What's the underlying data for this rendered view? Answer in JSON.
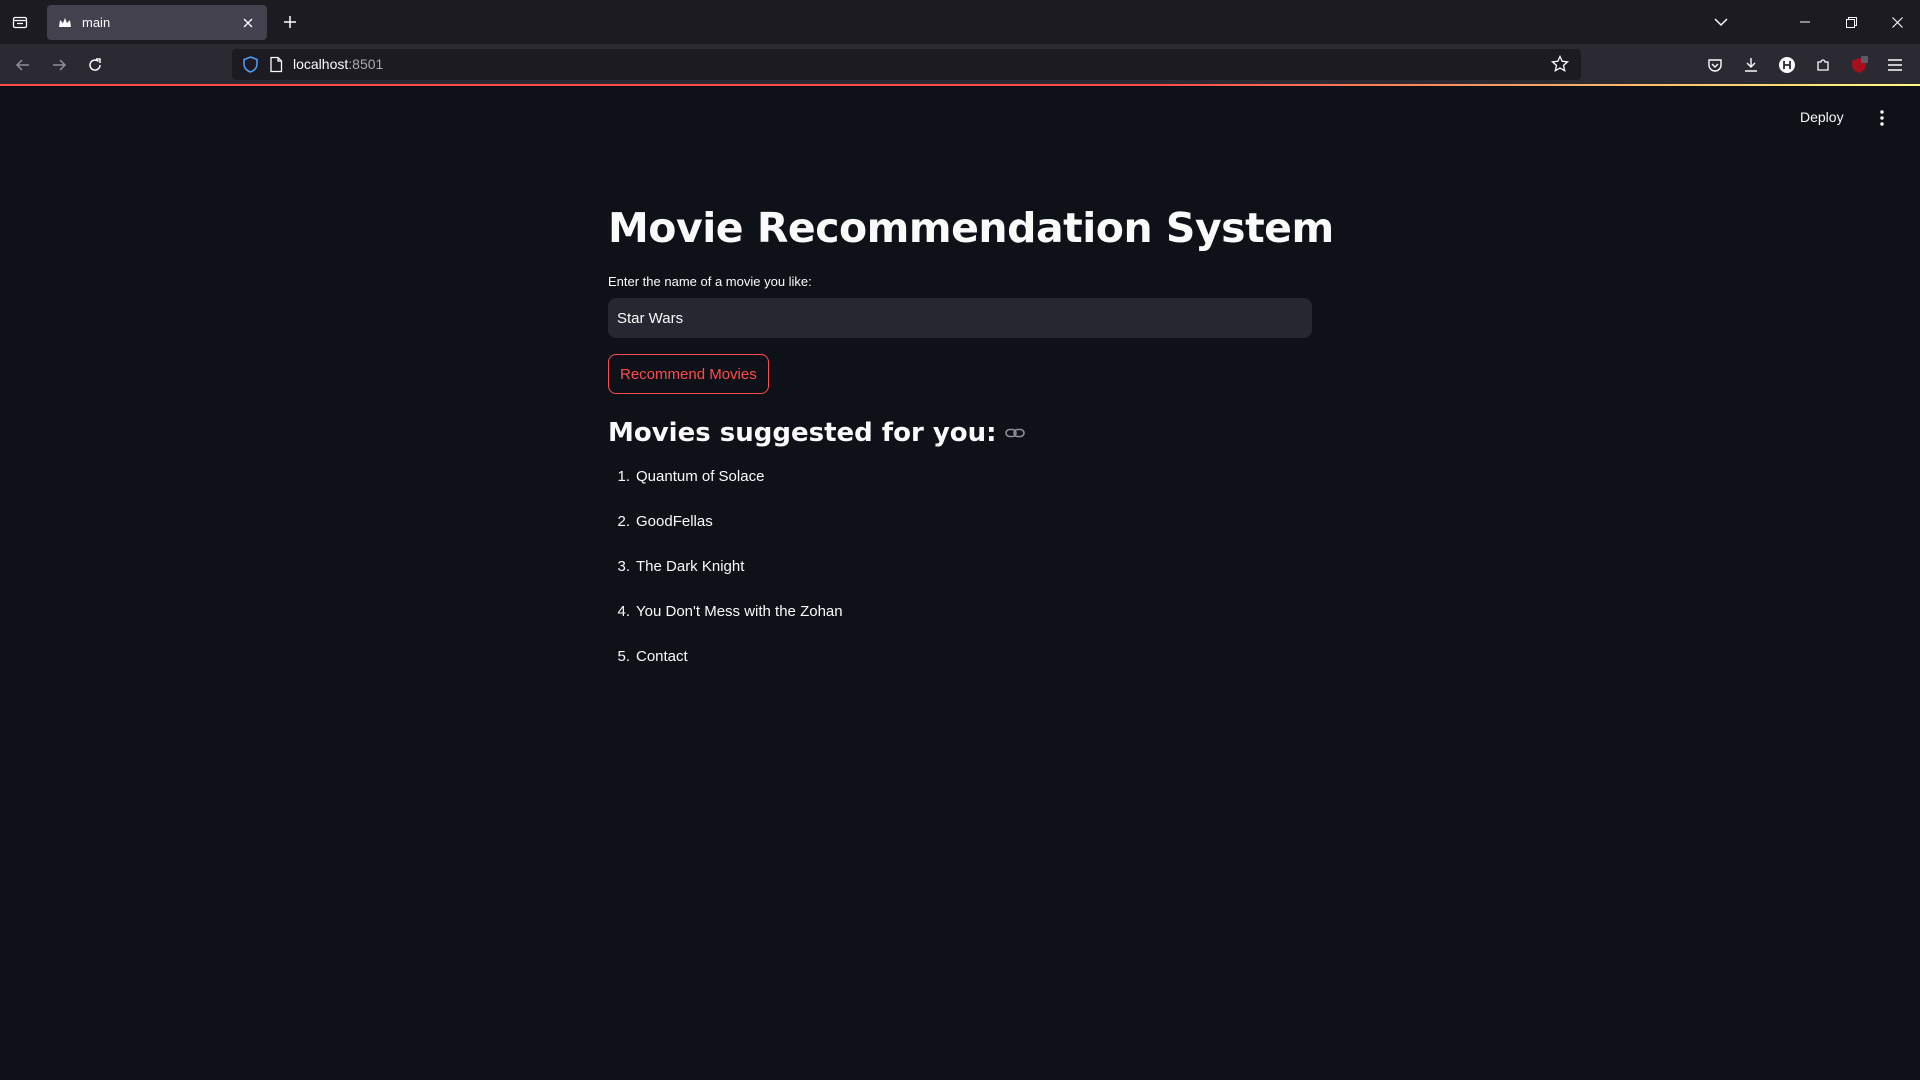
{
  "browser": {
    "tab": {
      "title": "main"
    },
    "url": {
      "host": "localhost",
      "port": ":8501"
    }
  },
  "app": {
    "header": {
      "deploy_label": "Deploy"
    },
    "title": "Movie Recommendation System",
    "input": {
      "label": "Enter the name of a movie you like:",
      "value": "Star Wars"
    },
    "button_label": "Recommend Movies",
    "results_heading": "Movies suggested for you:",
    "movies": [
      {
        "num": "1.",
        "title": "Quantum of Solace"
      },
      {
        "num": "2.",
        "title": "GoodFellas"
      },
      {
        "num": "3.",
        "title": "The Dark Knight"
      },
      {
        "num": "4.",
        "title": "You Don't Mess with the Zohan"
      },
      {
        "num": "5.",
        "title": "Contact"
      }
    ],
    "colors": {
      "accent": "#ff4b4b",
      "background": "#0e1117",
      "input_bg": "#262730"
    }
  },
  "icons": [
    "tab-list-icon",
    "streamlit-crown-icon",
    "close-icon",
    "plus-icon",
    "chevron-down-icon",
    "minimize-icon",
    "restore-icon",
    "back-arrow-icon",
    "forward-arrow-icon",
    "reload-icon",
    "shield-icon",
    "page-icon",
    "star-icon",
    "pocket-icon",
    "download-icon",
    "extension-icon",
    "menu-icon",
    "kebab-icon",
    "link-icon"
  ]
}
